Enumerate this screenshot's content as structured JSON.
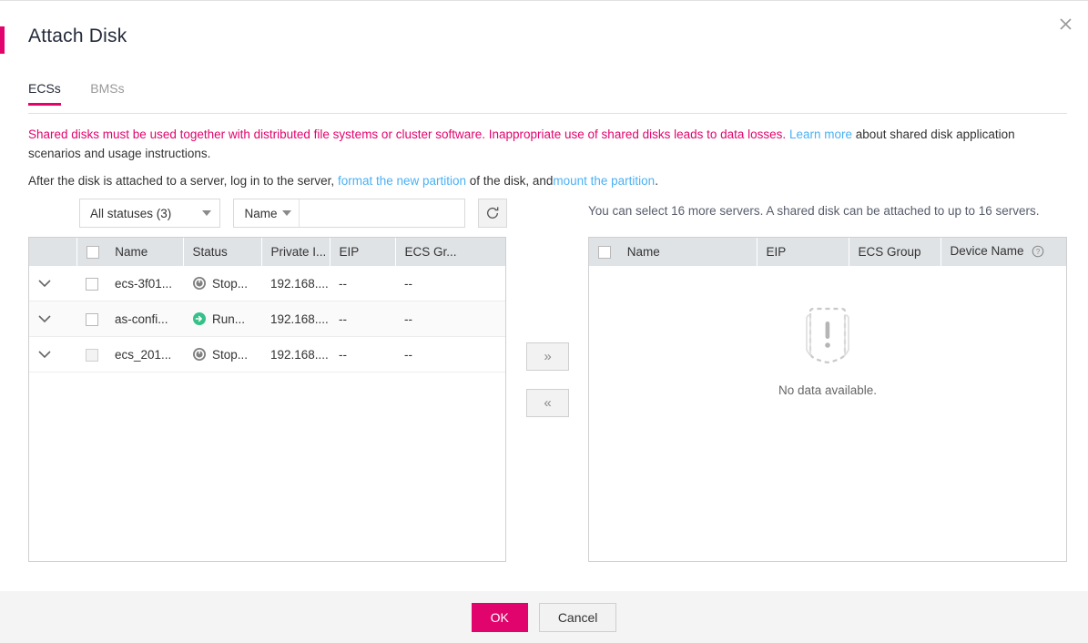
{
  "dialog": {
    "title": "Attach Disk",
    "close_label": "×",
    "accent_color": "#e2046d"
  },
  "tabs": [
    {
      "label": "ECSs",
      "active": true
    },
    {
      "label": "BMSs",
      "active": false
    }
  ],
  "notices": {
    "line1_warning": "Shared disks must be used together with distributed file systems or cluster software. Inappropriate use of shared disks leads to data losses.",
    "line1_link": "Learn more",
    "line1_tail": "about shared disk application scenarios and usage instructions.",
    "line2_prefix": "After the disk is attached to a server, log in to the server,",
    "line2_link1": "format the new partition",
    "line2_mid": "of the disk, and",
    "line2_link2": "mount the partition",
    "line2_suffix": "."
  },
  "toolbar": {
    "status_filter": "All statuses (3)",
    "search_field": "Name",
    "search_value": "",
    "search_placeholder": "",
    "search_icon": "search-icon",
    "refresh_icon": "refresh-icon"
  },
  "right_hint": "You can select 16 more servers. A shared disk can be attached to up to 16 servers.",
  "left_table": {
    "columns": [
      "Name",
      "Status",
      "Private I...",
      "EIP",
      "ECS Gr..."
    ],
    "rows": [
      {
        "name": "ecs-3f01...",
        "status": "Stop...",
        "status_type": "stopped",
        "private_ip": "192.168....",
        "eip": "--",
        "ecs_group": "--"
      },
      {
        "name": "as-confi...",
        "status": "Run...",
        "status_type": "running",
        "private_ip": "192.168....",
        "eip": "--",
        "ecs_group": "--"
      },
      {
        "name": "ecs_201...",
        "status": "Stop...",
        "status_type": "stopped",
        "private_ip": "192.168....",
        "eip": "--",
        "ecs_group": "--"
      }
    ]
  },
  "transfer": {
    "to_right": "»",
    "to_left": "«"
  },
  "right_table": {
    "columns": [
      "Name",
      "EIP",
      "ECS Group",
      "Device Name"
    ],
    "device_name_help_icon": "help-icon",
    "rows": [],
    "empty_text": "No data available."
  },
  "footer": {
    "ok_label": "OK",
    "cancel_label": "Cancel"
  },
  "colors": {
    "accent": "#e2046d",
    "link": "#4ab1f4",
    "running": "#36c189",
    "stopped": "#808080",
    "header_bg": "#e0e3e6",
    "footer_bg": "#f4f4f4"
  }
}
